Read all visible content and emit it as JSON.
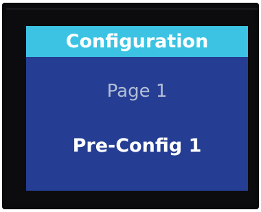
{
  "screen": {
    "title": "Configuration",
    "page_label": "Page 1",
    "selection": "Pre-Config 1"
  },
  "colors": {
    "bezel": "#0c0c0e",
    "screen_background": "#253e94",
    "header_background": "#3cc3e3",
    "title_text": "#ffffff",
    "page_text": "#b4bfd6",
    "selection_text": "#ffffff"
  }
}
